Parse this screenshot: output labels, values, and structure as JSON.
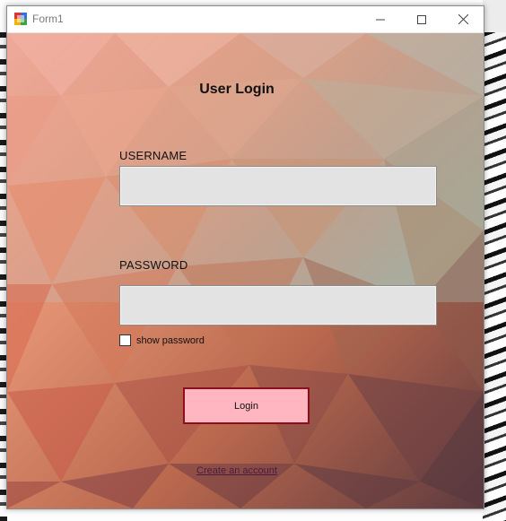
{
  "window": {
    "title": "Form1"
  },
  "titlebar_buttons": {
    "minimize_icon": "minimize-icon",
    "maximize_icon": "maximize-icon",
    "close_icon": "close-icon"
  },
  "form": {
    "heading": "User Login",
    "username_label": "USERNAME",
    "username_value": "",
    "password_label": "PASSWORD",
    "password_value": "",
    "show_password_label": "show password",
    "show_password_checked": false,
    "login_label": "Login",
    "create_account_label": "Create an account"
  },
  "colors": {
    "login_button_bg": "#ffb6c1",
    "login_button_border": "#8b0f1d",
    "input_bg": "#e3e3e3",
    "link_color": "#4a1b3d"
  }
}
